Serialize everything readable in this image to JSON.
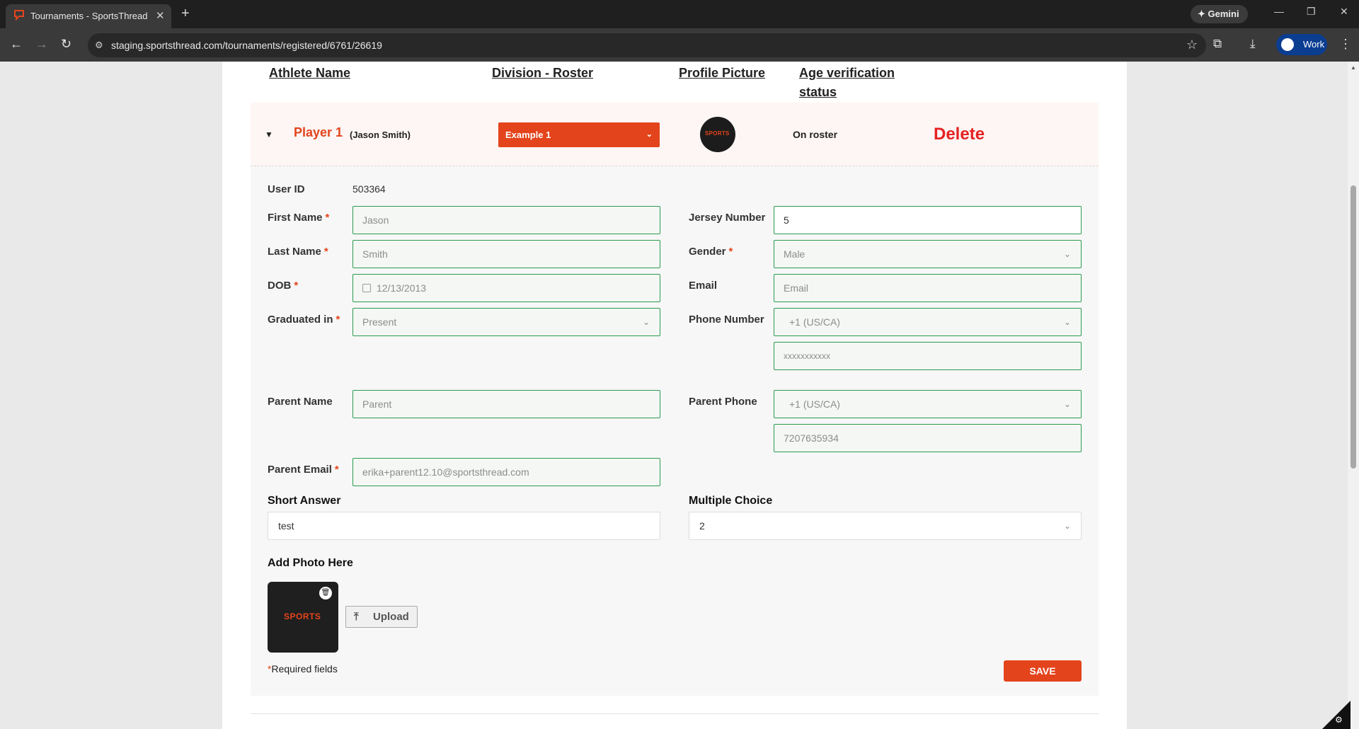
{
  "browser": {
    "tab_title": "Tournaments - SportsThread",
    "url": "staging.sportsthread.com/tournaments/registered/6761/26619",
    "gemini_label": "Gemini",
    "profile_label": "Work"
  },
  "table_headers": {
    "athlete_name": "Athlete Name",
    "division_roster": "Division - Roster",
    "profile_picture": "Profile Picture",
    "age_verification_line1": "Age verification",
    "age_verification_line2": "status"
  },
  "player": {
    "name": "Player 1",
    "full_name": "(Jason Smith)",
    "division": "Example 1",
    "logo_text": "SPORTS",
    "status": "On roster",
    "delete_label": "Delete"
  },
  "form": {
    "user_id_label": "User ID",
    "user_id_value": "503364",
    "first_name_label": "First Name",
    "first_name_value": "Jason",
    "last_name_label": "Last Name",
    "last_name_value": "Smith",
    "dob_label": "DOB",
    "dob_value": "12/13/2013",
    "graduated_label": "Graduated in",
    "graduated_value": "Present",
    "jersey_label": "Jersey Number",
    "jersey_value": "5",
    "gender_label": "Gender",
    "gender_value": "Male",
    "email_label": "Email",
    "email_placeholder": "Email",
    "phone_label": "Phone Number",
    "phone_country": "+1 (US/CA)",
    "phone_placeholder": "xxxxxxxxxxx",
    "parent_name_label": "Parent Name",
    "parent_name_placeholder": "Parent",
    "parent_phone_label": "Parent Phone",
    "parent_phone_country": "+1 (US/CA)",
    "parent_phone_value": "7207635934",
    "parent_email_label": "Parent Email",
    "parent_email_value": "erika+parent12.10@sportsthread.com",
    "short_answer_label": "Short Answer",
    "short_answer_value": "test",
    "multiple_choice_label": "Multiple Choice",
    "multiple_choice_value": "2",
    "add_photo_label": "Add Photo Here",
    "photo_logo_text": "SPORTS",
    "upload_label": "Upload",
    "required_star": "*",
    "required_note": "Required fields",
    "save_label": "SAVE"
  },
  "colors": {
    "accent": "#e4441c",
    "field_border": "#2c9b4f",
    "delete": "#e52222"
  }
}
